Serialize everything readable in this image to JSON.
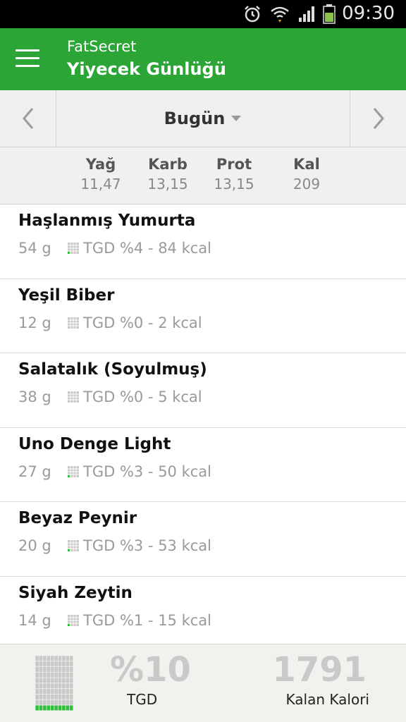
{
  "status_bar": {
    "time": "09:30"
  },
  "app_bar": {
    "app_name": "FatSecret",
    "title": "Yiyecek Günlüğü"
  },
  "date_nav": {
    "date": "Bugün"
  },
  "summary": {
    "fat": {
      "label": "Yağ",
      "value": "11,47"
    },
    "carb": {
      "label": "Karb",
      "value": "13,15"
    },
    "prot": {
      "label": "Prot",
      "value": "13,15"
    },
    "kcal": {
      "label": "Kal",
      "value": "209"
    }
  },
  "foods": [
    {
      "name": "Haşlanmış Yumurta",
      "qty": "54  g",
      "tgd": "TGD %4 - 84 kcal"
    },
    {
      "name": "Yeşil Biber",
      "qty": "12  g",
      "tgd": "TGD %0 - 2 kcal"
    },
    {
      "name": "Salatalık (Soyulmuş)",
      "qty": "38  g",
      "tgd": "TGD %0 - 5 kcal"
    },
    {
      "name": "Uno Denge Light",
      "qty": "27  g",
      "tgd": "TGD %3 - 50 kcal"
    },
    {
      "name": "Beyaz Peynir",
      "qty": "20  g",
      "tgd": "TGD %3 - 53 kcal"
    },
    {
      "name": "Siyah Zeytin",
      "qty": "14  g",
      "tgd": "TGD %1 - 15 kcal"
    }
  ],
  "footer": {
    "rdi_percent": "%10",
    "rdi_label": "TGD",
    "remaining_kcal": "1791",
    "remaining_label": "Kalan Kalori"
  },
  "colors": {
    "brand_green": "#2aa536",
    "grid_fill": "#2fbf3a"
  }
}
